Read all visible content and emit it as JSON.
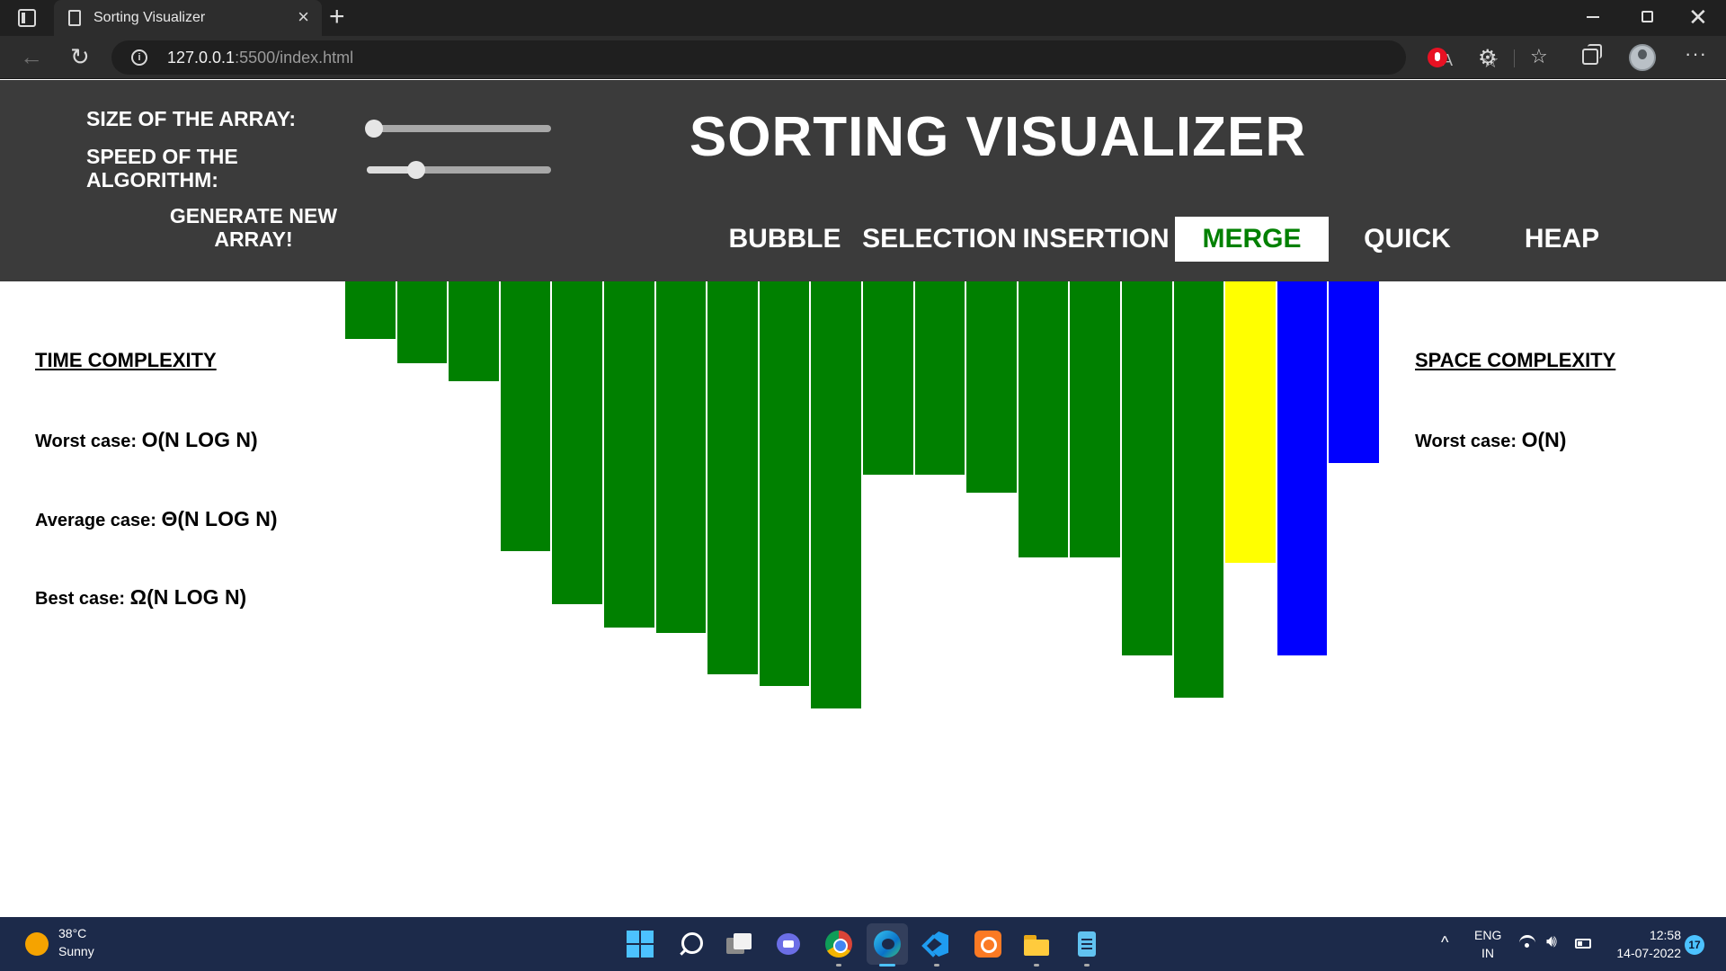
{
  "browser": {
    "tab_title": "Sorting Visualizer",
    "url_host": "127.0.0.1",
    "url_rest": ":5500/index.html"
  },
  "controls": {
    "size_label": "SIZE OF THE ARRAY:",
    "speed_label": "SPEED OF THE ALGORITHM:",
    "size_value_fraction": 0.04,
    "speed_value_fraction": 0.27,
    "generate_label": "GENERATE NEW ARRAY!"
  },
  "title": "SORTING VISUALIZER",
  "algorithms": [
    {
      "label": "BUBBLE",
      "active": false
    },
    {
      "label": "SELECTION",
      "active": false
    },
    {
      "label": "INSERTION",
      "active": false
    },
    {
      "label": "MERGE",
      "active": true
    },
    {
      "label": "QUICK",
      "active": false
    },
    {
      "label": "HEAP",
      "active": false
    }
  ],
  "colors": {
    "header_bg": "#3b3b3b",
    "active_text": "#008000",
    "bar_green": "#008000",
    "bar_yellow": "#ffff00",
    "bar_blue": "#0000ff"
  },
  "time_complexity": {
    "heading": "TIME COMPLEXITY",
    "worst_label": "Worst case: ",
    "worst_value": "O(N LOG N)",
    "average_label": "Average case: ",
    "average_value": "Θ(N LOG N)",
    "best_label": "Best case: ",
    "best_value": "Ω(N LOG N)"
  },
  "space_complexity": {
    "heading": "SPACE COMPLEXITY",
    "worst_label": "Worst case: ",
    "worst_value": "O(N)"
  },
  "array": {
    "values": [
      64,
      91,
      111,
      300,
      359,
      385,
      391,
      437,
      450,
      475,
      215,
      215,
      235,
      307,
      307,
      416,
      463,
      313,
      416,
      202
    ],
    "states": [
      "sorted",
      "sorted",
      "sorted",
      "sorted",
      "sorted",
      "sorted",
      "sorted",
      "sorted",
      "sorted",
      "sorted",
      "sorted",
      "sorted",
      "sorted",
      "sorted",
      "sorted",
      "sorted",
      "sorted",
      "comparing",
      "active",
      "active"
    ],
    "max": 480
  },
  "taskbar": {
    "temp": "38°C",
    "weather": "Sunny",
    "lang_top": "ENG",
    "lang_bottom": "IN",
    "time": "12:58",
    "date": "14-07-2022",
    "notifications": "17"
  }
}
